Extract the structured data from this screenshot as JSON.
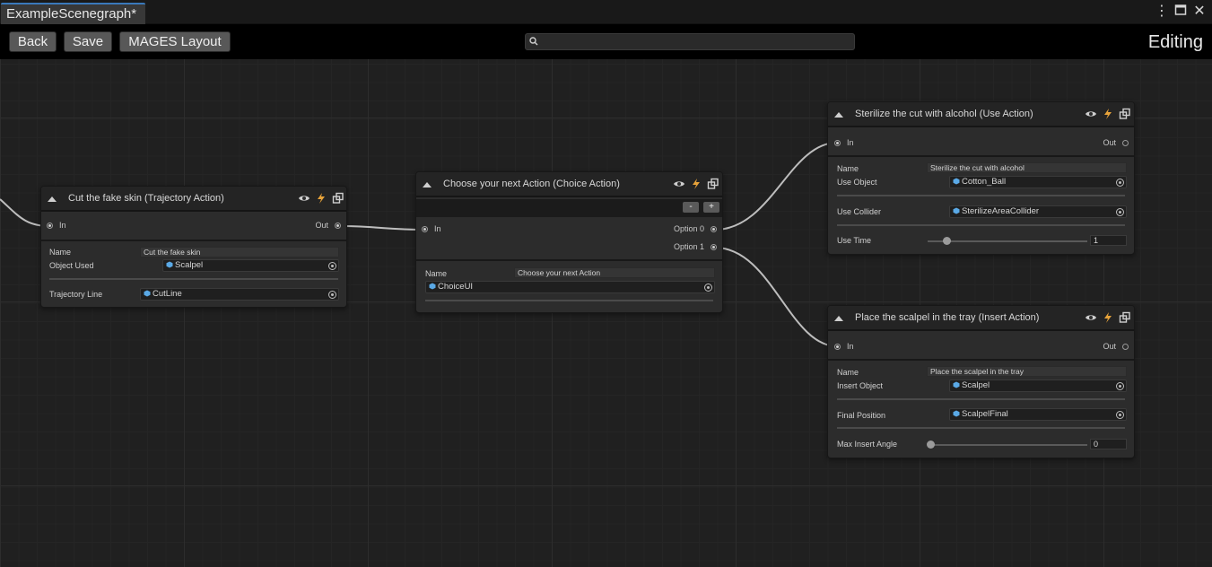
{
  "tab": {
    "title": "ExampleScenegraph*"
  },
  "toolbar": {
    "back": "Back",
    "save": "Save",
    "layout": "MAGES Layout",
    "search_value": "",
    "mode": "Editing"
  },
  "nodes": {
    "trajectory": {
      "title": "Cut the fake skin (Trajectory Action)",
      "in": "In",
      "out": "Out",
      "name_label": "Name",
      "name_value": "Cut the fake skin",
      "object_label": "Object Used",
      "object_value": "Scalpel",
      "line_label": "Trajectory Line",
      "line_value": "CutLine"
    },
    "choice": {
      "title": "Choose your next Action (Choice Action)",
      "minus": "-",
      "plus": "+",
      "in": "In",
      "option0": "Option 0",
      "option1": "Option 1",
      "name_label": "Name",
      "name_value": "Choose your next Action",
      "ui_value": "ChoiceUI"
    },
    "use": {
      "title": "Sterilize the cut with alcohol (Use Action)",
      "in": "In",
      "out": "Out",
      "name_label": "Name",
      "name_value": "Sterilize the cut with alcohol",
      "object_label": "Use Object",
      "object_value": "Cotton_Ball",
      "collider_label": "Use Collider",
      "collider_value": "SterilizeAreaCollider",
      "time_label": "Use Time",
      "time_value": "1",
      "time_fraction": 0.12
    },
    "insert": {
      "title": "Place the scalpel in the tray (Insert Action)",
      "in": "In",
      "out": "Out",
      "name_label": "Name",
      "name_value": "Place the scalpel in the tray",
      "object_label": "Insert Object",
      "object_value": "Scalpel",
      "final_label": "Final Position",
      "final_value": "ScalpelFinal",
      "angle_label": "Max Insert Angle",
      "angle_value": "0",
      "angle_fraction": 0.0
    }
  },
  "colors": {
    "accent": "#3a79bb",
    "lightning": "#e8a33a",
    "object_icon": "#5aa9e6"
  }
}
